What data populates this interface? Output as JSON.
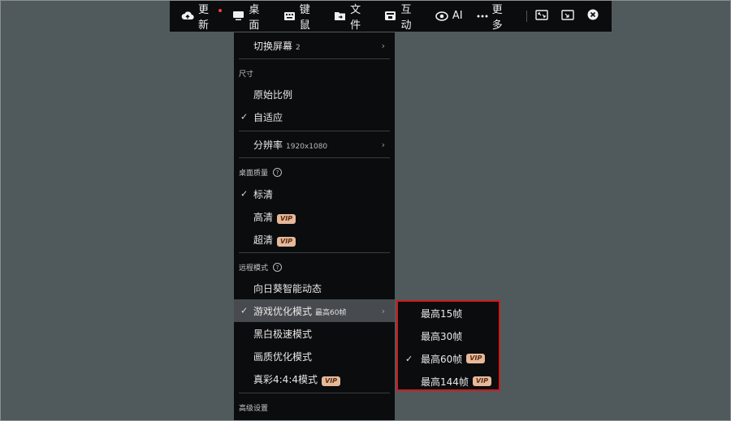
{
  "toolbar": {
    "update": "更新",
    "desktop": "桌面",
    "keyboard_mouse": "键鼠",
    "files": "文件",
    "interact": "互动",
    "ai": "AI",
    "more": "更多"
  },
  "menu": {
    "switch_screen": "切换屏幕",
    "switch_screen_count": "2",
    "size_section": "尺寸",
    "original_ratio": "原始比例",
    "adaptive": "自适应",
    "resolution": "分辨率",
    "resolution_value": "1920x1080",
    "quality_section": "桌面质量",
    "standard": "标清",
    "high": "高清",
    "ultra": "超清",
    "remote_section": "远程模式",
    "smart_dynamic": "向日葵智能动态",
    "game_mode": "游戏优化模式",
    "game_mode_sub": "最高60帧",
    "bw_mode": "黑白极速模式",
    "quality_mode": "画质优化模式",
    "true_color": "真彩4:4:4模式",
    "advanced_section": "高级设置",
    "vip": "VIP"
  },
  "submenu": {
    "fps15": "最高15帧",
    "fps30": "最高30帧",
    "fps60": "最高60帧",
    "fps144": "最高144帧"
  },
  "colors": {
    "background": "#505a5c",
    "menu_bg": "#0b0c0e",
    "highlight_border": "#d11a1a",
    "vip_badge": "#e6b99a"
  }
}
